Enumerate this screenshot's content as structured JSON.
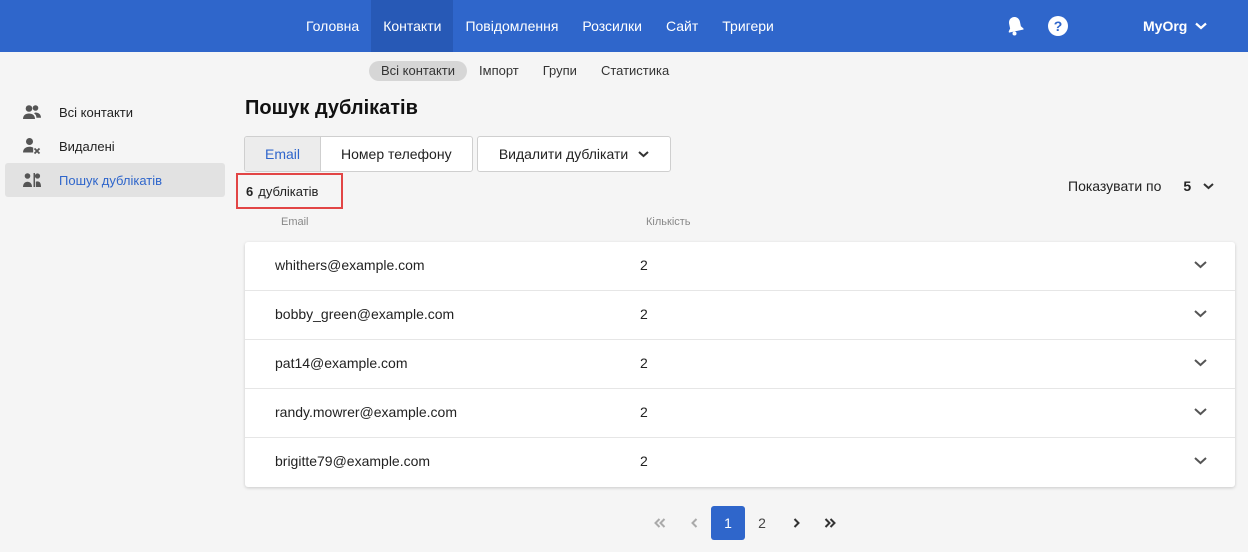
{
  "topnav": {
    "items": [
      {
        "label": "Головна",
        "active": false
      },
      {
        "label": "Контакти",
        "active": true
      },
      {
        "label": "Повідомлення",
        "active": false
      },
      {
        "label": "Розсилки",
        "active": false
      },
      {
        "label": "Сайт",
        "active": false
      },
      {
        "label": "Тригери",
        "active": false
      }
    ],
    "help_glyph": "?",
    "org": "MyOrg"
  },
  "subnav": {
    "items": [
      {
        "label": "Всі контакти",
        "active": true
      },
      {
        "label": "Імпорт",
        "active": false
      },
      {
        "label": "Групи",
        "active": false
      },
      {
        "label": "Статистика",
        "active": false
      }
    ]
  },
  "sidebar": {
    "items": [
      {
        "label": "Всі контакти",
        "icon": "users-icon",
        "active": false
      },
      {
        "label": "Видалені",
        "icon": "user-remove-icon",
        "active": false
      },
      {
        "label": "Пошук дублікатів",
        "icon": "user-duplicate-icon",
        "active": true
      }
    ]
  },
  "main": {
    "title": "Пошук дублікатів",
    "segment": {
      "email": "Email",
      "phone": "Номер телефону"
    },
    "delete_button": "Видалити дублікати",
    "dup_count": "6",
    "dup_label": "дублікатів",
    "per_page_label": "Показувати по",
    "per_page_value": "5",
    "columns": {
      "email": "Email",
      "count": "Кількість"
    },
    "rows": [
      {
        "email": "whithers@example.com",
        "count": "2"
      },
      {
        "email": "bobby_green@example.com",
        "count": "2"
      },
      {
        "email": "pat14@example.com",
        "count": "2"
      },
      {
        "email": "randy.mowrer@example.com",
        "count": "2"
      },
      {
        "email": "brigitte79@example.com",
        "count": "2"
      }
    ]
  },
  "pagination": {
    "pages": [
      "1",
      "2"
    ],
    "current": "1"
  },
  "colors": {
    "brand": "#2f66cb",
    "highlight": "#e24545"
  }
}
